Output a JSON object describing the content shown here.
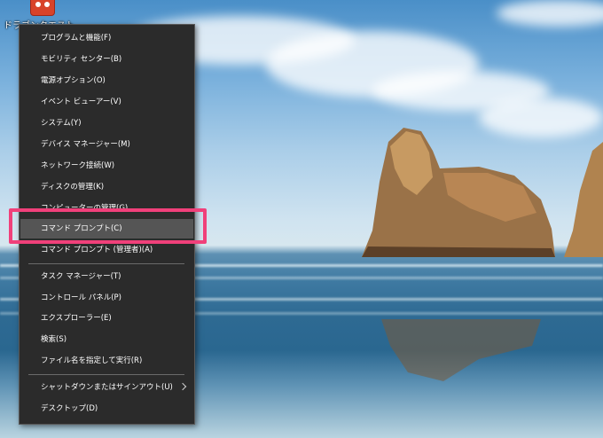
{
  "desktop": {
    "icon_label": "ドラゴンクエスト"
  },
  "menu": {
    "items": [
      "プログラムと機能(F)",
      "モビリティ センター(B)",
      "電源オプション(O)",
      "イベント ビューアー(V)",
      "システム(Y)",
      "デバイス マネージャー(M)",
      "ネットワーク接続(W)",
      "ディスクの管理(K)",
      "コンピューターの管理(G)",
      "コマンド プロンプト(C)",
      "コマンド プロンプト (管理者)(A)",
      "タスク マネージャー(T)",
      "コントロール パネル(P)",
      "エクスプローラー(E)",
      "検索(S)",
      "ファイル名を指定して実行(R)",
      "シャットダウンまたはサインアウト(U)",
      "デスクトップ(D)"
    ],
    "highlighted_item": "コマンド プロンプト(C)"
  },
  "colors": {
    "menu_background": "#2b2b2b",
    "menu_text": "#ffffff",
    "menu_highlight": "#555555",
    "annotation_box": "#f0407a"
  },
  "icons": {
    "desktop_app": "red-robot-game-icon",
    "submenu": "chevron-right-icon"
  }
}
